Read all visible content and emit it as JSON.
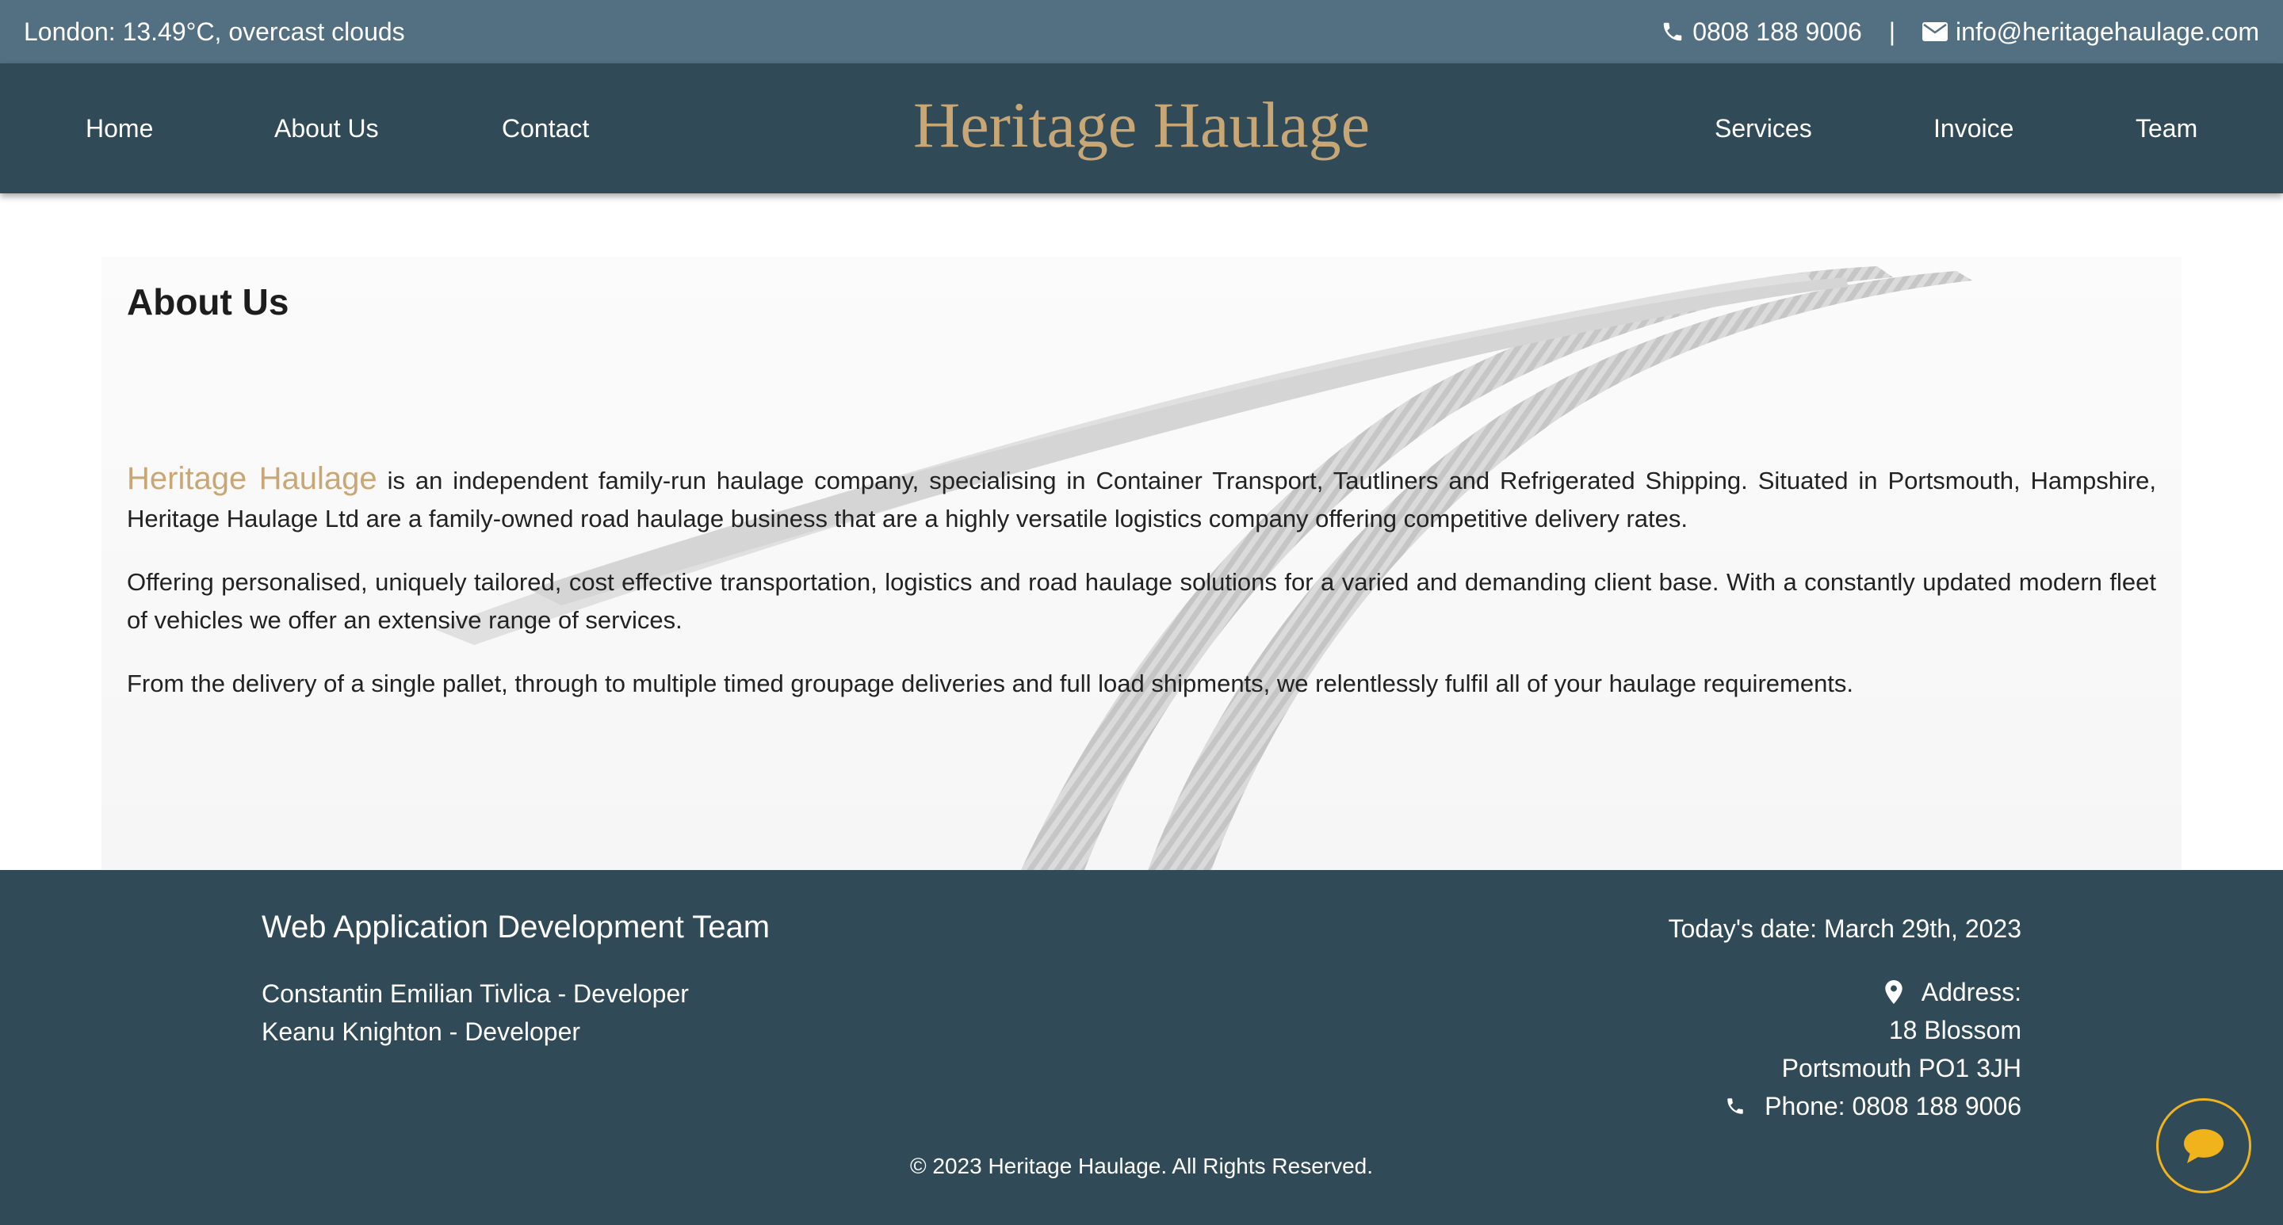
{
  "topbar": {
    "weather": "London: 13.49°C, overcast clouds",
    "phone": "0808 188 9006",
    "separator": "|",
    "email": "info@heritagehaulage.com",
    "icons": [
      "phone-icon",
      "envelope-icon"
    ]
  },
  "nav": {
    "left": [
      "Home",
      "About Us",
      "Contact"
    ],
    "brand": "Heritage Haulage",
    "right": [
      "Services",
      "Invoice",
      "Team"
    ]
  },
  "main": {
    "title": "About Us",
    "highlight": "Heritage Haulage",
    "p1_rest": " is an independent family-run haulage company, specialising in Container Transport, Tautliners and Refrigerated Shipping. Situated in Portsmouth, Hampshire, Heritage Haulage Ltd are a family-owned road haulage business that are a highly versatile logistics company offering competitive delivery rates.",
    "p2": "Offering personalised, uniquely tailored, cost effective transportation, logistics and road haulage solutions for a varied and demanding client base. With a constantly updated modern fleet of vehicles we offer an extensive range of services.",
    "p3": "From the delivery of a single pallet, through to multiple timed groupage deliveries and full load shipments, we relentlessly fulfil all of your haulage requirements."
  },
  "footer": {
    "team_title": "Web Application Development Team",
    "team": [
      "Constantin Emilian Tivlica - Developer",
      "Keanu Knighton - Developer"
    ],
    "date": "Today's date: March 29th, 2023",
    "address_label": "Address:",
    "address_line1": "18 Blossom",
    "address_line2": "Portsmouth PO1 3JH",
    "phone": "Phone: 0808 188 9006",
    "copyright": "© 2023 Heritage Haulage. All Rights Reserved."
  },
  "colors": {
    "topbar": "#536f82",
    "navbar": "#314a58",
    "brand_gold": "#c9a775",
    "chat_ring": "#f0b31b"
  }
}
